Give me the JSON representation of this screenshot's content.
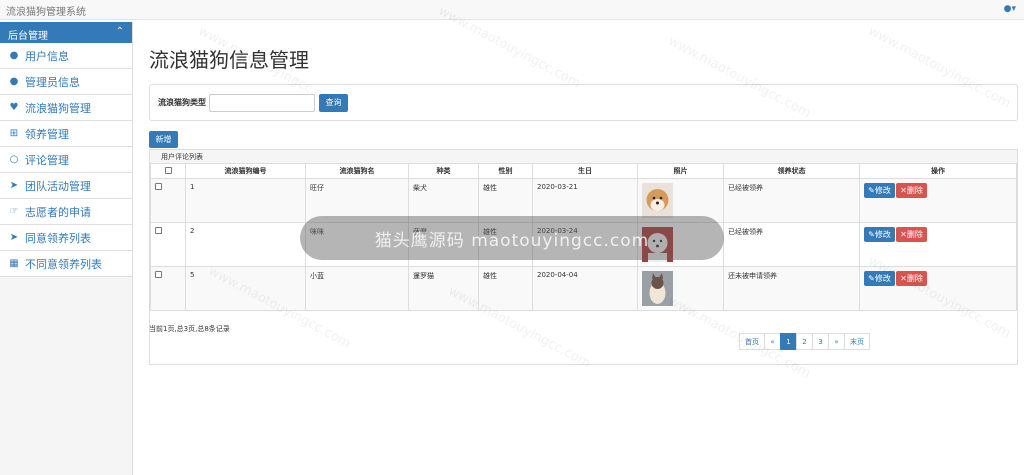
{
  "app": {
    "title": "流浪猫狗管理系统",
    "user_icon": "user-icon"
  },
  "sidebar": {
    "header": "后台管理",
    "items": [
      {
        "label": "用户信息",
        "icon": "user-icon"
      },
      {
        "label": "管理员信息",
        "icon": "users-icon"
      },
      {
        "label": "流浪猫狗管理",
        "icon": "heartbeat-icon"
      },
      {
        "label": "领养管理",
        "icon": "plus-square-icon"
      },
      {
        "label": "评论管理",
        "icon": "comment-icon"
      },
      {
        "label": "团队活动管理",
        "icon": "rocket-icon"
      },
      {
        "label": "志愿者的申请",
        "icon": "hand-icon"
      },
      {
        "label": "同意领养列表",
        "icon": "send-icon"
      },
      {
        "label": "不同意领养列表",
        "icon": "sitemap-icon"
      }
    ]
  },
  "page": {
    "title": "流浪猫狗信息管理",
    "search_label": "流浪猫狗类型",
    "search_value": "",
    "query_button": "查询",
    "add_button": "新增",
    "panel_title": "用户评论列表",
    "columns": [
      "",
      "流浪猫狗编号",
      "流浪猫狗名",
      "种类",
      "性别",
      "生日",
      "照片",
      "领养状态",
      "操作"
    ],
    "rows": [
      {
        "id": "1",
        "name": "旺仔",
        "kind": "柴犬",
        "gender": "雄性",
        "birthday": "2020-03-21",
        "status": "已经被领养"
      },
      {
        "id": "2",
        "name": "咪咪",
        "kind": "萨摩",
        "gender": "雄性",
        "birthday": "2020-03-24",
        "status": "已经被领养"
      },
      {
        "id": "5",
        "name": "小蓝",
        "kind": "暹罗猫",
        "gender": "雄性",
        "birthday": "2020-04-04",
        "status": "还未被申请领养"
      }
    ],
    "edit_label": "修改",
    "delete_label": "删除",
    "footer": "当前1页,总3页,总8条记录",
    "pagination": [
      "首页",
      "«",
      "1",
      "2",
      "3",
      "»",
      "末页"
    ],
    "active_page": "1"
  },
  "watermark": {
    "center": "猫头鹰源码 maotouyingcc.com",
    "text": "www.maotouyingcc.com"
  },
  "colors": {
    "primary": "#337ab7",
    "danger": "#d9534f"
  }
}
